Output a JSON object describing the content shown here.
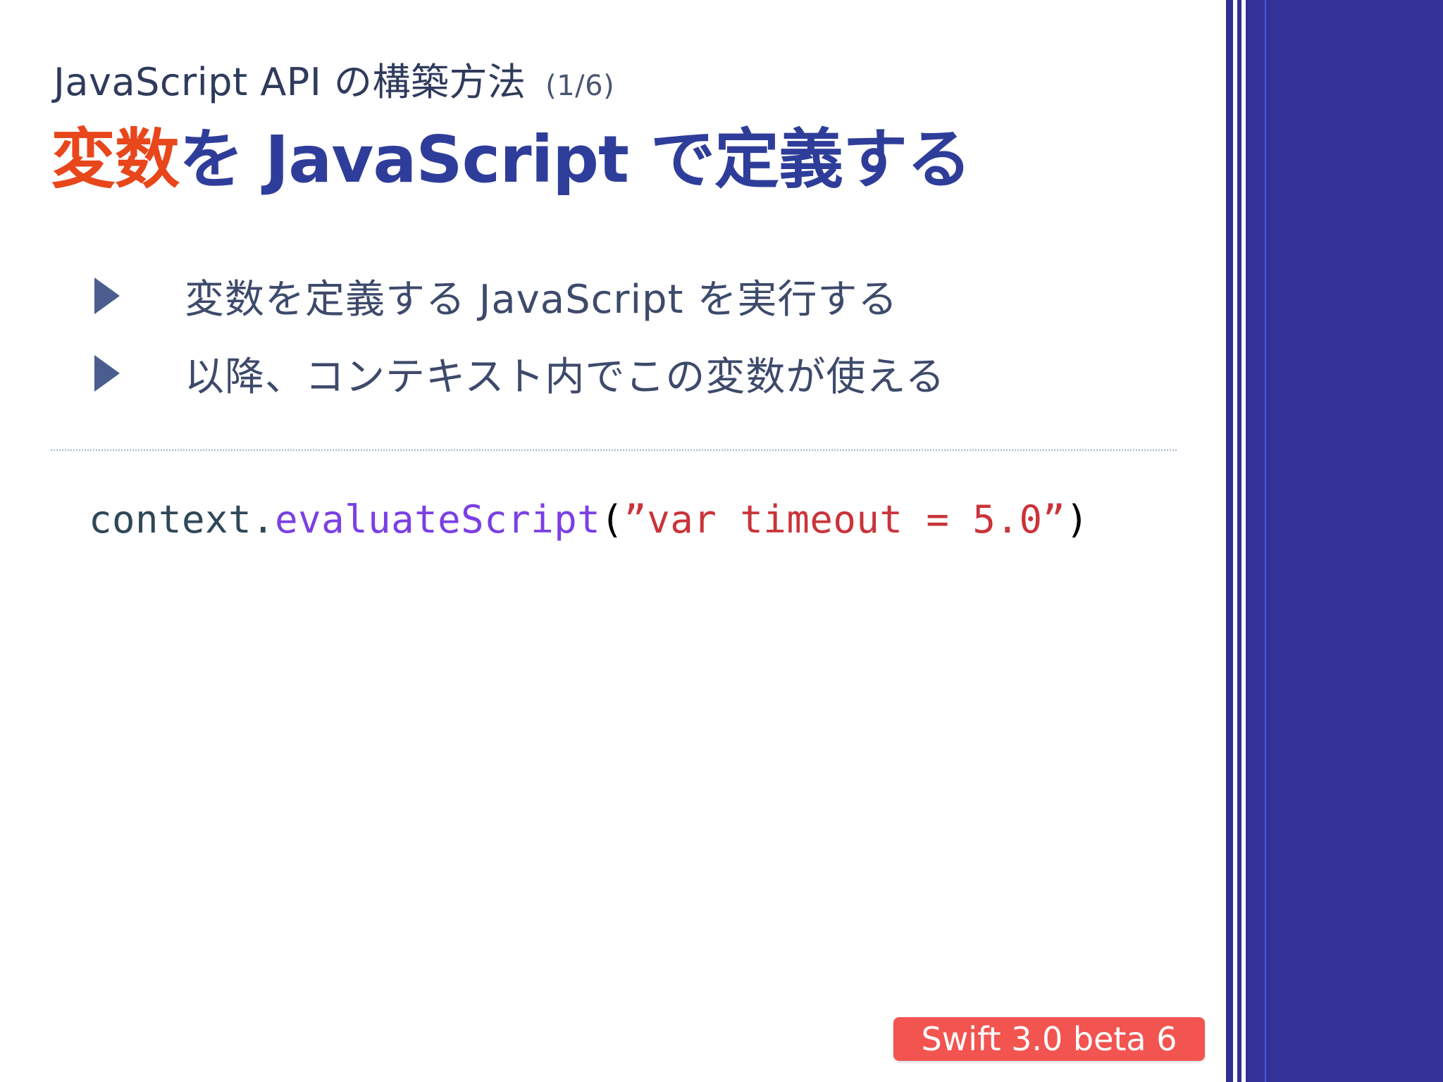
{
  "slide": {
    "subtitle": "JavaScript API の構築方法",
    "page_indicator": "(1/6)",
    "title_accent": "変数",
    "title_rest": "を JavaScript で定義する",
    "bullets": [
      {
        "icon": "triangle-right-icon",
        "text": "変数を定義する JavaScript を実行する"
      },
      {
        "icon": "triangle-right-icon",
        "text": "以降、コンテキスト内でこの変数が使える"
      }
    ],
    "code": {
      "receiver": "context",
      "dot": ".",
      "method": "evaluateScript",
      "open_paren": "(",
      "string_literal": "”var timeout = 5.0”",
      "close_paren": ")"
    },
    "badge": "Swift 3.0 beta 6"
  },
  "colors": {
    "title_accent": "#e8461b",
    "title_main": "#2f3d9a",
    "sidebar": "#333399",
    "code_receiver": "#2f4858",
    "code_method": "#7b3fe4",
    "code_string": "#c9343a",
    "code_paren": "#000000",
    "badge": "#f25450"
  }
}
